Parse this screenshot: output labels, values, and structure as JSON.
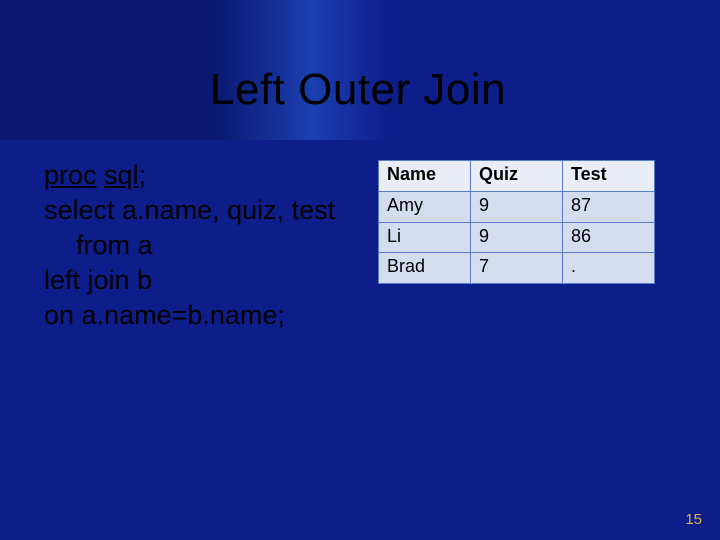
{
  "title": "Left Outer Join",
  "code": {
    "line1_a": "proc",
    "line1_b": "sql",
    "line1_c": ";",
    "line2": "select a.name, quiz, test",
    "line3": "from a",
    "line4": "left join b",
    "line5": "on a.name=b.name;"
  },
  "table": {
    "headers": {
      "c0": "Name",
      "c1": "Quiz",
      "c2": "Test"
    },
    "rows": [
      {
        "c0": "Amy",
        "c1": "9",
        "c2": "87"
      },
      {
        "c0": "Li",
        "c1": "9",
        "c2": "86"
      },
      {
        "c0": "Brad",
        "c1": "7",
        "c2": "."
      }
    ]
  },
  "chart_data": {
    "type": "table",
    "title": "Left Outer Join",
    "columns": [
      "Name",
      "Quiz",
      "Test"
    ],
    "rows": [
      [
        "Amy",
        9,
        87
      ],
      [
        "Li",
        9,
        86
      ],
      [
        "Brad",
        7,
        null
      ]
    ]
  },
  "page_number": "15"
}
